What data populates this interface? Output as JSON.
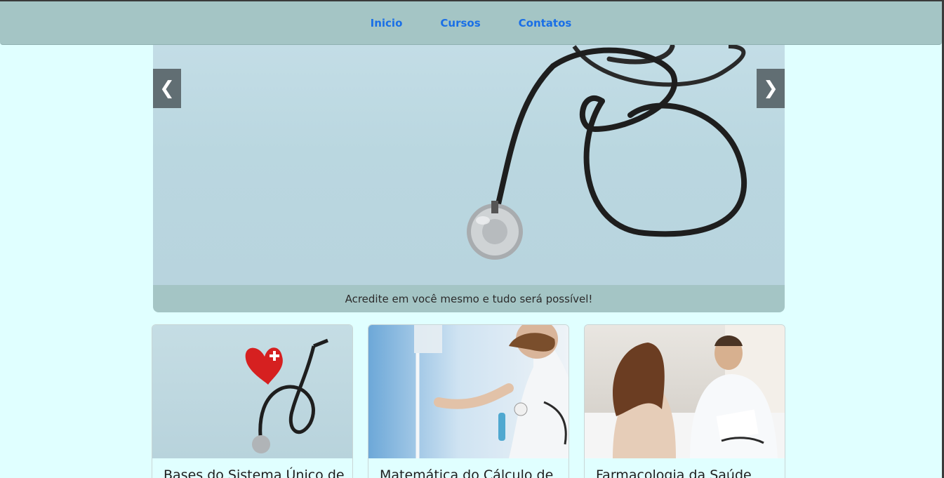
{
  "nav": {
    "items": [
      "Inicio",
      "Cursos",
      "Contatos"
    ],
    "link_color": "#1a6fe6",
    "bar_color": "#a4c5c5"
  },
  "carousel": {
    "prev_icon": "❮",
    "next_icon": "❯",
    "caption": "Acredite em você mesmo e tudo será possível!"
  },
  "cards": [
    {
      "title": "Bases do Sistema Único de"
    },
    {
      "title": "Matemática do Cálculo de"
    },
    {
      "title": "Farmacologia da Saúde"
    }
  ],
  "colors": {
    "page_background": "#e0ffff",
    "caption_background": "#a4c5c5"
  }
}
